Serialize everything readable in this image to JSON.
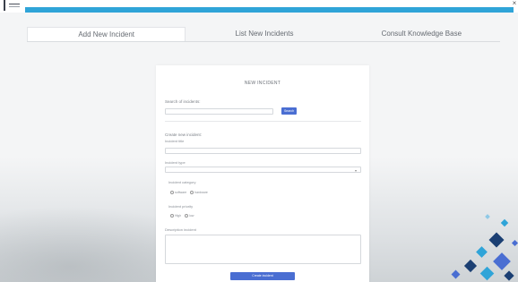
{
  "window": {
    "close_glyph": "×"
  },
  "tabs": [
    {
      "label": "Add New Incident",
      "active": true
    },
    {
      "label": "List New Incidents",
      "active": false
    },
    {
      "label": "Consult Knowledge Base",
      "active": false
    }
  ],
  "form": {
    "title": "NEW INCIDENT",
    "search": {
      "label": "Search of incidents:",
      "value": "",
      "button": "Search"
    },
    "create_heading": "Create new incident:",
    "incident_title": {
      "label": "Incident title",
      "value": ""
    },
    "incident_type": {
      "label": "Incident type",
      "value": ""
    },
    "incident_category": {
      "label": "Incident category",
      "options": [
        "software",
        "hardware"
      ]
    },
    "incident_priority": {
      "label": "Incident priority",
      "options": [
        "High",
        "low"
      ]
    },
    "description": {
      "label": "Description incident",
      "value": ""
    },
    "submit": "Create incident"
  },
  "colors": {
    "accent_bar": "#2fa4d8",
    "button": "#4a6ed2",
    "decoration": [
      "#2fa4d8",
      "#4a6ed2",
      "#1b3f73"
    ]
  }
}
